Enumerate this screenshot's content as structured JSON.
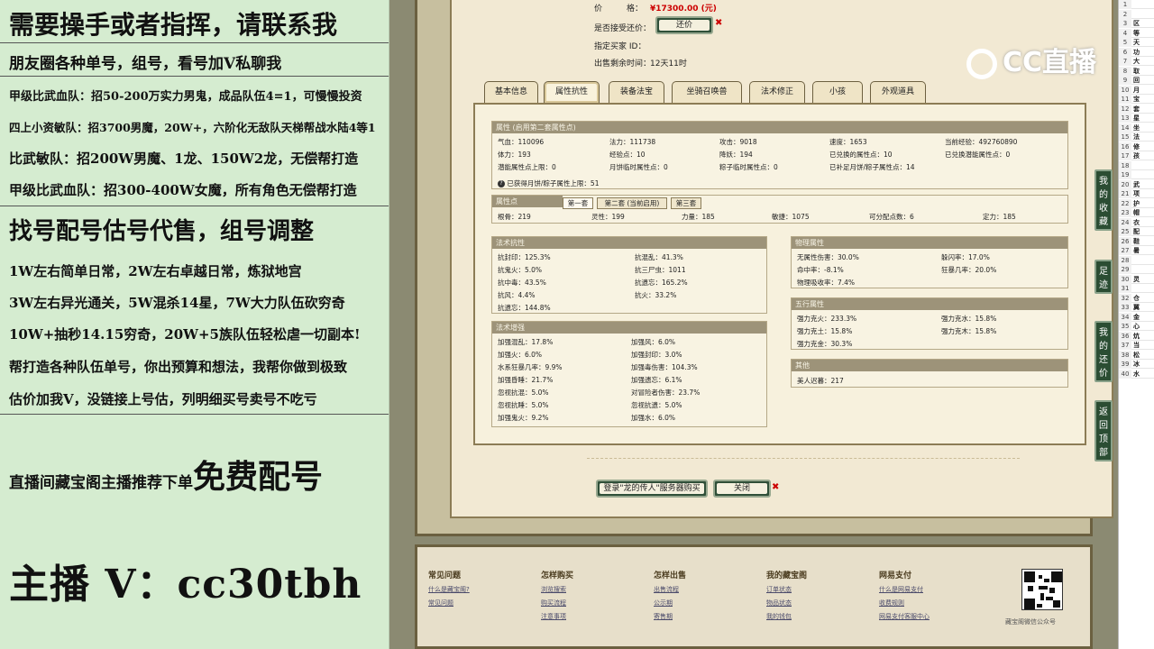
{
  "left": {
    "line1": "需要操手或者指挥，请联系我",
    "line2": "朋友圈各种单号，组号，看号加V私聊我",
    "line3": "甲级比武血队：招50-200万实力男鬼，成品队伍4=1，可慢慢投资",
    "line4": "四上小资敏队：招3700男魔，20W+，六阶化无敌队天梯帮战水陆4等1",
    "line5": "比武敏队：招200W男魔、1龙、150W2龙，无偿帮打造",
    "line6": "甲级比武血队：招300-400W女魔，所有角色无偿帮打造",
    "line7": "找号配号估号代售，组号调整",
    "line8": "1W左右简单日常，2W左右卓越日常，炼狱地宫",
    "line9": "3W左右异光通关，5W混杀14星，7W大力队伍砍穷奇",
    "line10": "10W+抽秒14.15穷奇，20W+5族队伍轻松虐一切副本!",
    "line11": "帮打造各种队伍单号，你出预算和想法，我帮你做到极致",
    "line12": "估价加我V，没链接上号估，列明细买号卖号不吃亏",
    "line13a": "直播间藏宝阁主播推荐下单",
    "line13b": "免费配号",
    "line14": "主播 V：cc30tbh"
  },
  "sale": {
    "price_label": "价　　　格：",
    "price_value": "¥17300.00 (元)",
    "bargain_label": "是否接受还价：",
    "bargain_btn": "还价",
    "buyer_label": "指定买家 ID：",
    "buyer_value": "",
    "time_label": "出售剩余时间：",
    "time_value": "12天11时"
  },
  "tabs": [
    "基本信息",
    "属性抗性",
    "装备法宝",
    "坐骑召唤兽",
    "法术修正",
    "小孩",
    "外观道具"
  ],
  "active_tab": "属性抗性",
  "attr": {
    "header": "属性 (启用第二套属性点)",
    "rows": [
      [
        "气血：110096",
        "法力：111738",
        "攻击：9018",
        "速度：1653",
        "当前经验：492760890"
      ],
      [
        "体力：193",
        "经验点：10",
        "降妖：194",
        "已兑换的属性点：10",
        "已兑换潜能属性点：0"
      ],
      [
        "潜能属性点上限：0",
        "月饼临时属性点：0",
        "粽子临时属性点：0",
        "已补足月饼/粽子属性点：14",
        ""
      ]
    ],
    "note": "已获得月饼/粽子属性上限：51"
  },
  "points": {
    "header": "属性点",
    "subtabs": [
      "第一套",
      "第二套 (当前启用)",
      "第三套"
    ],
    "values": [
      "根骨：219",
      "灵性：199",
      "力量：185",
      "敏捷：1075",
      "可分配点数：6",
      "定力：185"
    ]
  },
  "resist": {
    "header": "法术抗性",
    "cells": [
      [
        "抗封印：125.3%",
        "抗混乱：41.3%"
      ],
      [
        "抗鬼火：5.0%",
        "抗三尸虫：1011"
      ],
      [
        "抗中毒：43.5%",
        "抗遗忘：165.2%"
      ],
      [
        "抗风：4.4%",
        "抗火：33.2%"
      ],
      [
        "抗遗忘：144.8%",
        ""
      ]
    ]
  },
  "enhance": {
    "header": "法术增强",
    "cells": [
      [
        "加强混乱：17.8%",
        "加强风：6.0%"
      ],
      [
        "加强火：6.0%",
        "加强封印：3.0%"
      ],
      [
        "水系狂暴几率：9.9%",
        "加强毒伤害：104.3%"
      ],
      [
        "加强昏睡：21.7%",
        "加强遗忘：6.1%"
      ],
      [
        "忽视抗混：5.0%",
        "对冒险者伤害：23.7%"
      ],
      [
        "忽视抗睡：5.0%",
        "忽视抗遗：5.0%"
      ],
      [
        "加强鬼火：9.2%",
        "加强水：6.0%"
      ]
    ]
  },
  "physical": {
    "header": "物理属性",
    "cells": [
      [
        "无属性伤害：30.0%",
        "躲闪率：17.0%"
      ],
      [
        "命中率：-8.1%",
        "狂暴几率：20.0%"
      ],
      [
        "物理吸收率：7.4%",
        ""
      ]
    ]
  },
  "five": {
    "header": "五行属性",
    "cells": [
      [
        "强力克火：233.3%",
        "强力克水：15.8%"
      ],
      [
        "强力克土：15.8%",
        "强力克木：15.8%"
      ],
      [
        "强力克金：30.3%",
        ""
      ]
    ]
  },
  "other": {
    "header": "其他",
    "value": "美人迟暮：217"
  },
  "bottom": {
    "buy_btn": "登录\"龙的传人\"服务器购买",
    "close_btn": "关闭"
  },
  "footer": {
    "cols": [
      {
        "title": "常见问题",
        "links": [
          "什么是藏宝阁?",
          "常见问题"
        ]
      },
      {
        "title": "怎样购买",
        "links": [
          "浏览搜索",
          "购买流程",
          "注意事项"
        ]
      },
      {
        "title": "怎样出售",
        "links": [
          "出售流程",
          "公示期",
          "寄售期"
        ]
      },
      {
        "title": "我的藏宝阁",
        "links": [
          "订单状态",
          "物品状态",
          "我的钱包"
        ]
      },
      {
        "title": "网易支付",
        "links": [
          "什么是网易支付",
          "收费规则",
          "网易支付客服中心"
        ]
      }
    ],
    "qr_caption": "藏宝阁微信公众号"
  },
  "cc_logo": "CC直播",
  "side_buttons": [
    "我的收藏",
    "足迹",
    "我的还价",
    "返回顶部"
  ],
  "sheet_rows": [
    {
      "n": "1",
      "t": ""
    },
    {
      "n": "2",
      "t": ""
    },
    {
      "n": "3",
      "t": "区"
    },
    {
      "n": "4",
      "t": "等"
    },
    {
      "n": "5",
      "t": "天"
    },
    {
      "n": "6",
      "t": "功"
    },
    {
      "n": "7",
      "t": "大"
    },
    {
      "n": "8",
      "t": "取"
    },
    {
      "n": "9",
      "t": "回"
    },
    {
      "n": "10",
      "t": "月"
    },
    {
      "n": "11",
      "t": "宝"
    },
    {
      "n": "12",
      "t": "套"
    },
    {
      "n": "13",
      "t": "星"
    },
    {
      "n": "14",
      "t": "坐"
    },
    {
      "n": "15",
      "t": "法"
    },
    {
      "n": "16",
      "t": "修"
    },
    {
      "n": "17",
      "t": "孩"
    },
    {
      "n": "18",
      "t": ""
    },
    {
      "n": "19",
      "t": ""
    },
    {
      "n": "20",
      "t": "武"
    },
    {
      "n": "21",
      "t": "项"
    },
    {
      "n": "22",
      "t": "护"
    },
    {
      "n": "23",
      "t": "帽"
    },
    {
      "n": "24",
      "t": "衣"
    },
    {
      "n": "25",
      "t": "配"
    },
    {
      "n": "26",
      "t": "鞋"
    },
    {
      "n": "27",
      "t": "暑"
    },
    {
      "n": "28",
      "t": ""
    },
    {
      "n": "29",
      "t": ""
    },
    {
      "n": "30",
      "t": "灵"
    },
    {
      "n": "31",
      "t": ""
    },
    {
      "n": "32",
      "t": "仓"
    },
    {
      "n": "33",
      "t": "翼"
    },
    {
      "n": "34",
      "t": "金"
    },
    {
      "n": "35",
      "t": "心"
    },
    {
      "n": "36",
      "t": "炕"
    },
    {
      "n": "37",
      "t": "当"
    },
    {
      "n": "38",
      "t": "松"
    },
    {
      "n": "39",
      "t": "冰"
    },
    {
      "n": "40",
      "t": "水"
    }
  ]
}
